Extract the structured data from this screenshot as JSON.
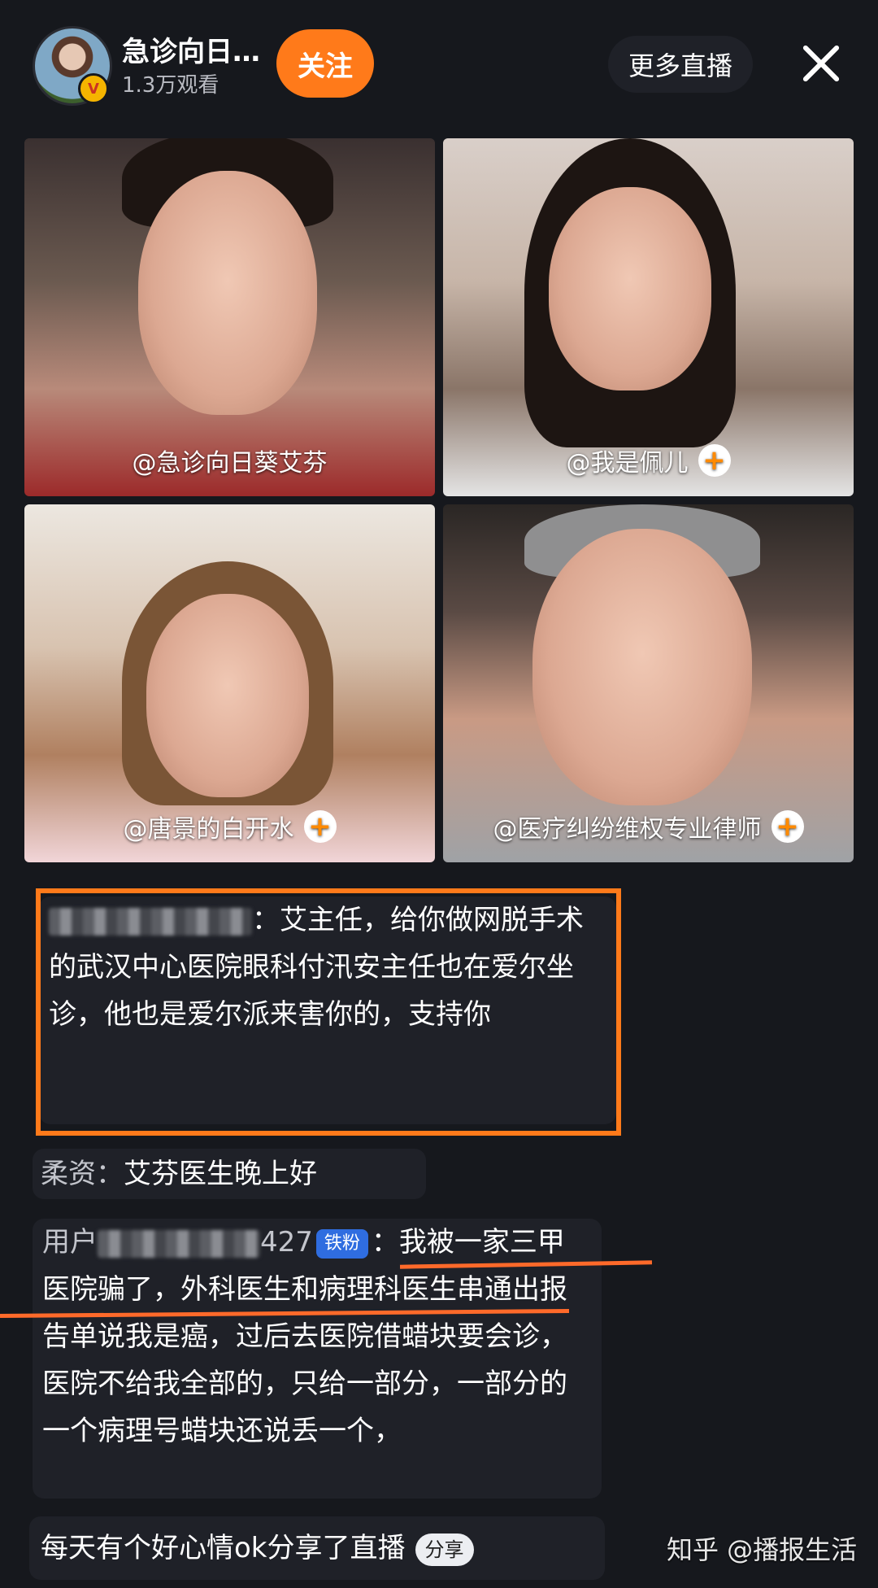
{
  "header": {
    "host_name": "急诊向日…",
    "viewers": "1.3万观看",
    "follow_label": "关注",
    "more_live_label": "更多直播",
    "close_icon": "close-icon"
  },
  "tiles": [
    {
      "label": "@急诊向日葵艾芬"
    },
    {
      "label": "@我是佩儿",
      "plus": "+"
    },
    {
      "label": "@唐景的白开水",
      "plus": "+"
    },
    {
      "label": "@医疗纠纷维权专业律师",
      "plus": "+"
    }
  ],
  "chat": {
    "msg1": {
      "text_line1": "：艾主任，给你做网",
      "text_rest": "脱手术的武汉中心医院眼科付汛安主任也在爱尔坐诊，他也是爱尔派来害你的，支持你"
    },
    "msg2": {
      "user": "柔资：",
      "text": "艾芬医生晚上好"
    },
    "msg3": {
      "user_prefix": "用户",
      "user_suffix": "427",
      "badge": "铁粉",
      "text_line1": "：我被一家三",
      "text_rest": "甲医院骗了，外科医生和病理科医生串通出报告单说我是癌，过后去医院借蜡块要会诊，医院不给我全部的，只给一部分，一部分的一个病理号蜡块还说丢一个，"
    },
    "msg4": {
      "text": "每天有个好心情ok分享了直播",
      "badge": "分享"
    }
  },
  "watermark": "知乎 @播报生活",
  "colors": {
    "accent": "#ff7a1a",
    "background": "#16181d",
    "fan_badge": "#2f6de0"
  }
}
